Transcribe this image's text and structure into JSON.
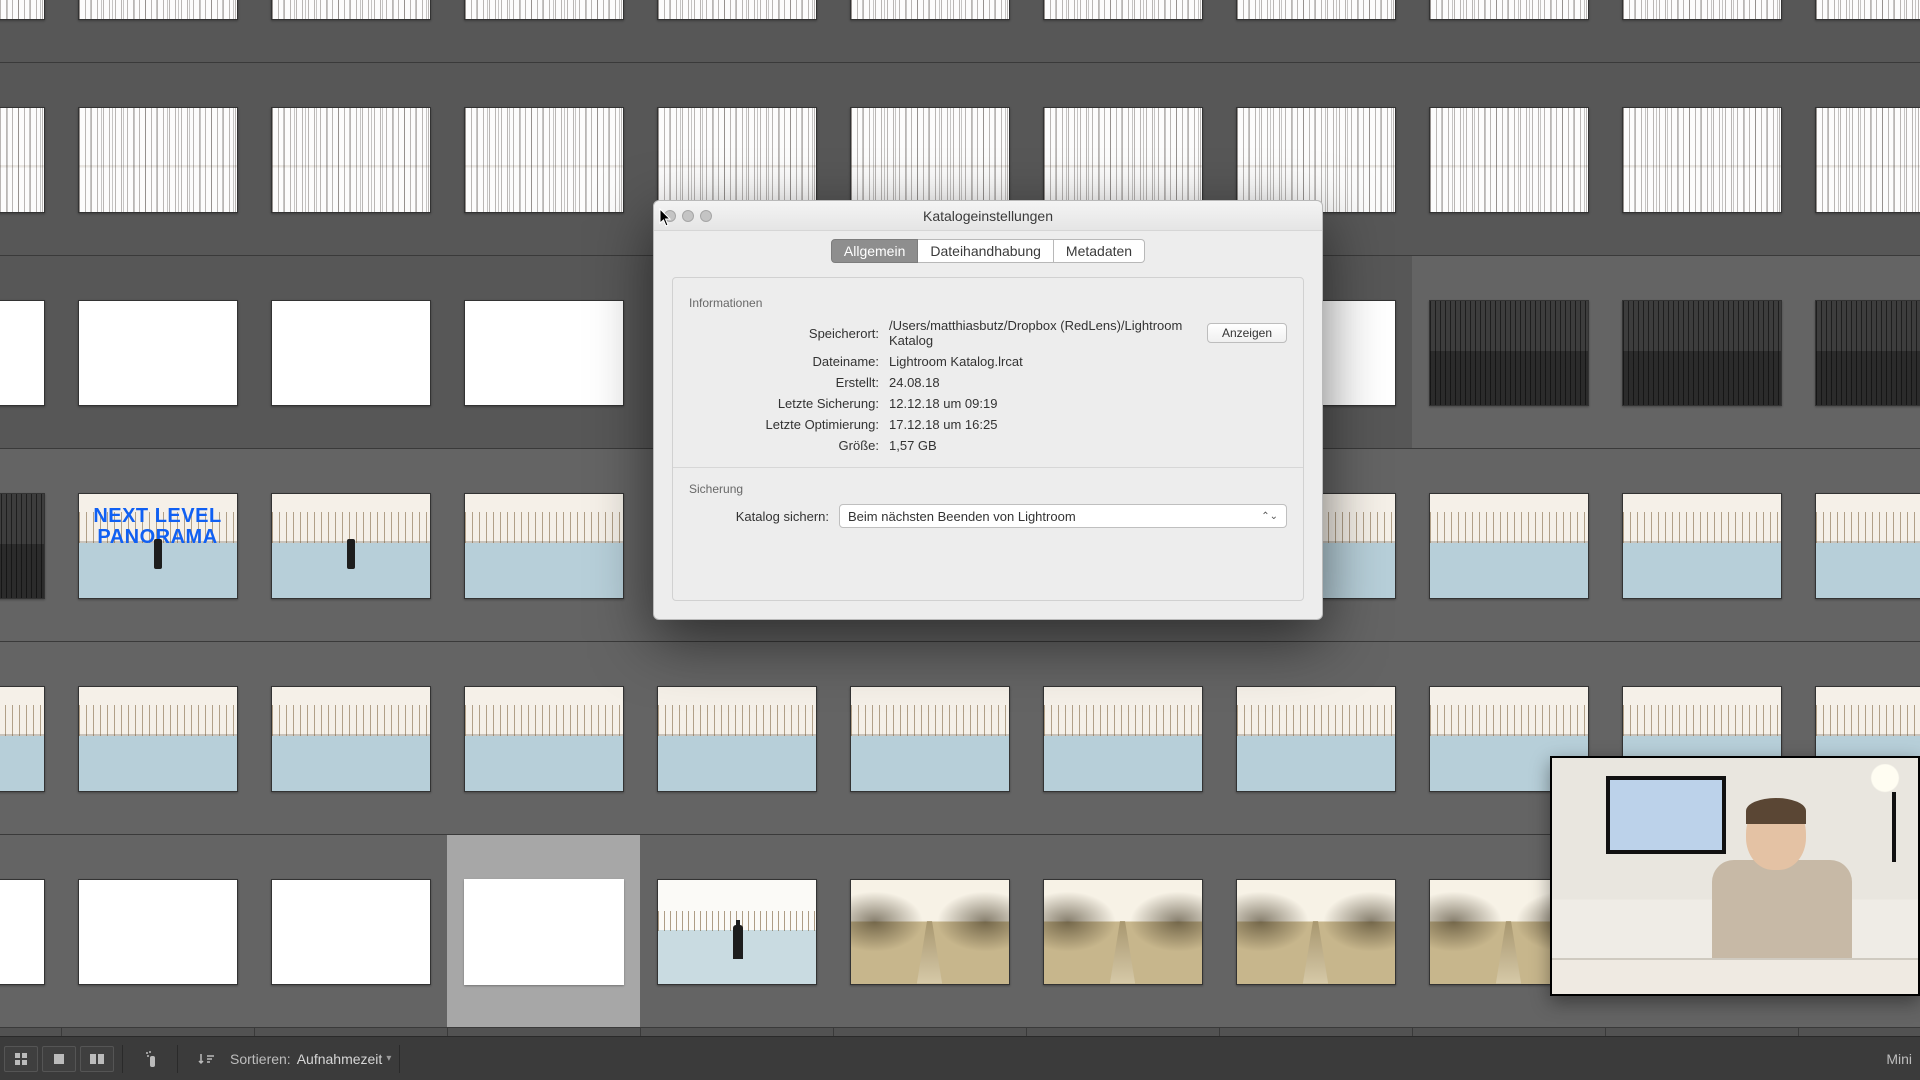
{
  "dialog": {
    "title": "Katalogeinstellungen",
    "tabs": {
      "general": "Allgemein",
      "file": "Dateihandhabung",
      "meta": "Metadaten"
    },
    "info_section": "Informationen",
    "show_button": "Anzeigen",
    "fields": {
      "location_label": "Speicherort:",
      "location_value": "/Users/matthiasbutz/Dropbox (RedLens)/Lightroom Katalog",
      "filename_label": "Dateiname:",
      "filename_value": "Lightroom Katalog.lrcat",
      "created_label": "Erstellt:",
      "created_value": "24.08.18",
      "lastbackup_label": "Letzte Sicherung:",
      "lastbackup_value": "12.12.18 um 09:19",
      "lastopt_label": "Letzte Optimierung:",
      "lastopt_value": "17.12.18 um 16:25",
      "size_label": "Größe:",
      "size_value": "1,57 GB"
    },
    "backup_section": "Sicherung",
    "backup_label": "Katalog sichern:",
    "backup_value": "Beim nächsten Beenden von Lightroom"
  },
  "bottom_bar": {
    "sort_label": "Sortieren:",
    "sort_value": "Aufnahmezeit",
    "right_text": "Mini"
  },
  "pano_stamp": {
    "line1": "NEXT LEVEL",
    "line2": "PANORAMA"
  }
}
